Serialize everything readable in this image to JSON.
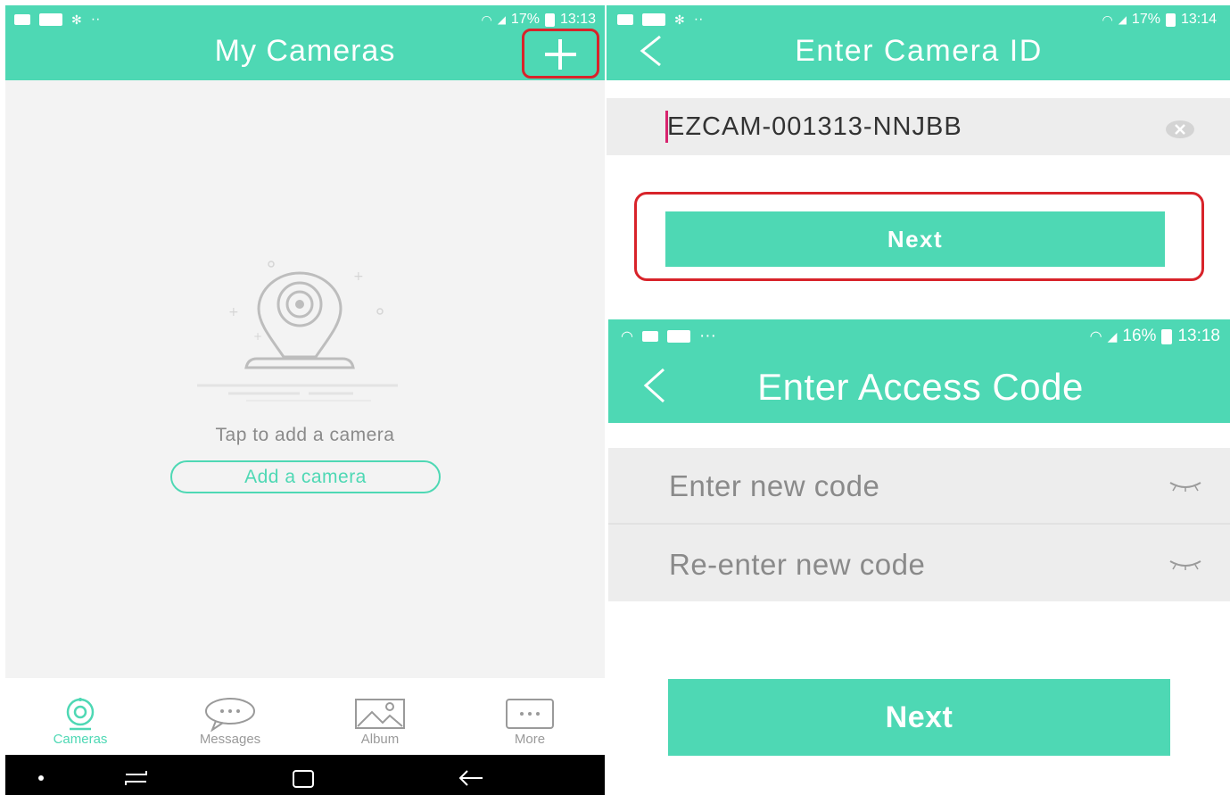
{
  "screens": {
    "my_cameras": {
      "status": {
        "battery": "17%",
        "time": "13:13"
      },
      "title": "My Cameras",
      "add_icon": "plus-icon",
      "empty_state": {
        "illustration": "camera-illustration",
        "hint": "Tap to add a camera",
        "button_label": "Add a camera"
      },
      "bottom_nav": [
        {
          "label": "Cameras",
          "icon": "camera-icon",
          "active": true
        },
        {
          "label": "Messages",
          "icon": "chat-bubble-icon",
          "active": false
        },
        {
          "label": "Album",
          "icon": "picture-icon",
          "active": false
        },
        {
          "label": "More",
          "icon": "more-icon",
          "active": false
        }
      ]
    },
    "enter_camera_id": {
      "status": {
        "battery": "17%",
        "time": "13:14"
      },
      "title": "Enter Camera ID",
      "camera_id_value": "EZCAM-001313-NNJBB",
      "next_label": "Next"
    },
    "enter_access_code": {
      "status": {
        "battery": "16%",
        "time": "13:18"
      },
      "title": "Enter Access Code",
      "new_code_placeholder": "Enter new code",
      "reenter_code_placeholder": "Re-enter new code",
      "next_label": "Next"
    }
  },
  "colors": {
    "accent": "#4ed8b4",
    "highlight": "#d8232a",
    "background": "#f3f3f3",
    "input_bg": "#ededed"
  }
}
